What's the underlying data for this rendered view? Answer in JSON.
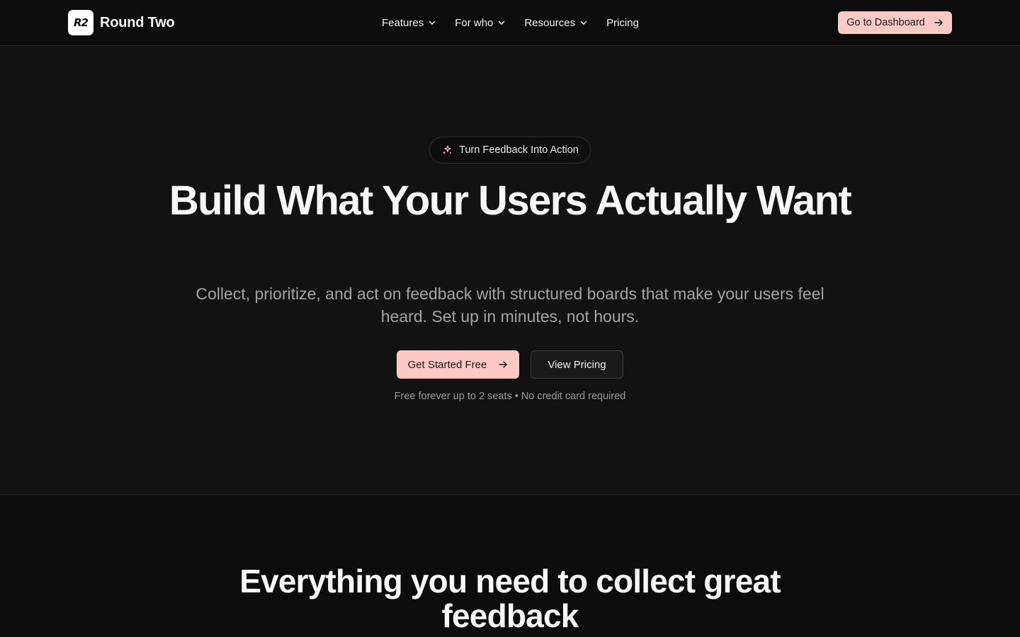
{
  "header": {
    "brand": {
      "logo_text": "R2",
      "name": "Round Two"
    },
    "nav": [
      {
        "label": "Features",
        "has_dropdown": true
      },
      {
        "label": "For who",
        "has_dropdown": true
      },
      {
        "label": "Resources",
        "has_dropdown": true
      },
      {
        "label": "Pricing",
        "has_dropdown": false
      }
    ],
    "dashboard_button": "Go to Dashboard"
  },
  "hero": {
    "badge": "Turn Feedback Into Action",
    "title": "Build What Your Users Actually Want",
    "subtitle": "Collect, prioritize, and act on feedback with structured boards that make your users feel heard. Set up in minutes, not hours.",
    "primary_cta": "Get Started Free",
    "secondary_cta": "View Pricing",
    "fine_print": "Free forever up to 2 seats • No credit card required"
  },
  "features": {
    "title": "Everything you need to collect great feedback"
  },
  "colors": {
    "accent": "#fcc9c5",
    "background": "#121212",
    "header_background": "#0c0c0c"
  },
  "icons": {
    "badge": "sparkles-icon",
    "dropdown": "chevron-down-icon",
    "cta": "arrow-right-icon"
  }
}
